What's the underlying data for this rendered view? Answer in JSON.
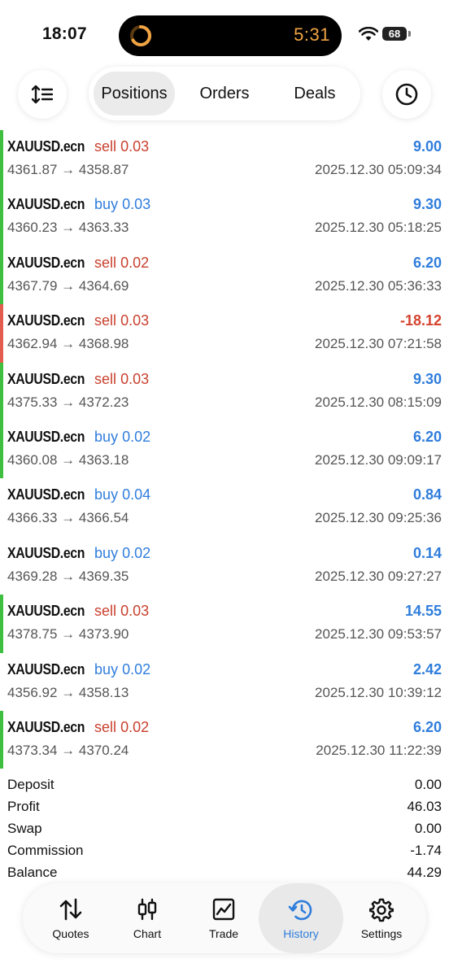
{
  "status": {
    "time": "18:07",
    "timer": "5:31",
    "battery": "68"
  },
  "segments": [
    "Positions",
    "Orders",
    "Deals"
  ],
  "trades": [
    {
      "symbol": "XAUUSD.ecn",
      "side": "sell",
      "volume": "0.03",
      "profit": "9.00",
      "prices": "4361.87 → 4358.87",
      "time": "2025.12.30 05:09:34",
      "bar": "#3fbf3f"
    },
    {
      "symbol": "XAUUSD.ecn",
      "side": "buy",
      "volume": "0.03",
      "profit": "9.30",
      "prices": "4360.23 → 4363.33",
      "time": "2025.12.30 05:18:25",
      "bar": "#3fbf3f"
    },
    {
      "symbol": "XAUUSD.ecn",
      "side": "sell",
      "volume": "0.02",
      "profit": "6.20",
      "prices": "4367.79 → 4364.69",
      "time": "2025.12.30 05:36:33",
      "bar": "#3fbf3f"
    },
    {
      "symbol": "XAUUSD.ecn",
      "side": "sell",
      "volume": "0.03",
      "profit": "-18.12",
      "prices": "4362.94 → 4368.98",
      "time": "2025.12.30 07:21:58",
      "bar": "#e35d4f"
    },
    {
      "symbol": "XAUUSD.ecn",
      "side": "sell",
      "volume": "0.03",
      "profit": "9.30",
      "prices": "4375.33 → 4372.23",
      "time": "2025.12.30 08:15:09",
      "bar": "#3fbf3f"
    },
    {
      "symbol": "XAUUSD.ecn",
      "side": "buy",
      "volume": "0.02",
      "profit": "6.20",
      "prices": "4360.08 → 4363.18",
      "time": "2025.12.30 09:09:17",
      "bar": "#3fbf3f"
    },
    {
      "symbol": "XAUUSD.ecn",
      "side": "buy",
      "volume": "0.04",
      "profit": "0.84",
      "prices": "4366.33 → 4366.54",
      "time": "2025.12.30 09:25:36",
      "bar": ""
    },
    {
      "symbol": "XAUUSD.ecn",
      "side": "buy",
      "volume": "0.02",
      "profit": "0.14",
      "prices": "4369.28 → 4369.35",
      "time": "2025.12.30 09:27:27",
      "bar": ""
    },
    {
      "symbol": "XAUUSD.ecn",
      "side": "sell",
      "volume": "0.03",
      "profit": "14.55",
      "prices": "4378.75 → 4373.90",
      "time": "2025.12.30 09:53:57",
      "bar": "#3fbf3f"
    },
    {
      "symbol": "XAUUSD.ecn",
      "side": "buy",
      "volume": "0.02",
      "profit": "2.42",
      "prices": "4356.92 → 4358.13",
      "time": "2025.12.30 10:39:12",
      "bar": ""
    },
    {
      "symbol": "XAUUSD.ecn",
      "side": "sell",
      "volume": "0.02",
      "profit": "6.20",
      "prices": "4373.34 → 4370.24",
      "time": "2025.12.30 11:22:39",
      "bar": "#3fbf3f"
    }
  ],
  "summary": [
    {
      "label": "Deposit",
      "value": "0.00"
    },
    {
      "label": "Profit",
      "value": "46.03"
    },
    {
      "label": "Swap",
      "value": "0.00"
    },
    {
      "label": "Commission",
      "value": "-1.74"
    },
    {
      "label": "Balance",
      "value": "44.29"
    }
  ],
  "tabbar": {
    "quotes": "Quotes",
    "chart": "Chart",
    "trade": "Trade",
    "history": "History",
    "settings": "Settings",
    "active_color": "#2f7ddc"
  },
  "icons": [
    "sort-icon",
    "history-clock-icon",
    "quotes-arrows-icon",
    "chart-candles-icon",
    "trade-chart-icon",
    "history-icon",
    "settings-gear-icon"
  ]
}
